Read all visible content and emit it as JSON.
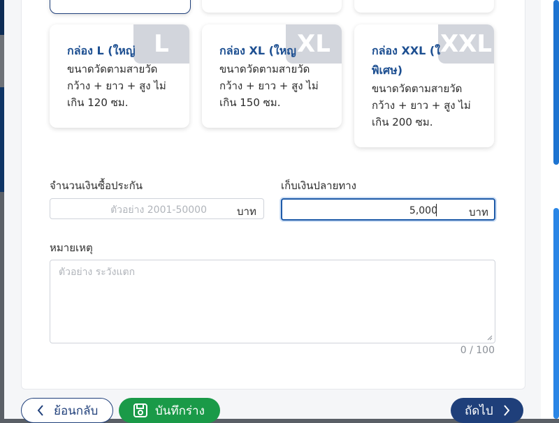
{
  "box_options": [
    {
      "title": "กล่อง L (ใหญ่",
      "badge": "L",
      "description": "ขนาดวัดตามสายวัด กว้าง + ยาว + สูง ไม่เกิน 120 ซม."
    },
    {
      "title": "กล่อง XL (ใหญ",
      "badge": "XL",
      "description": "ขนาดวัดตามสายวัด กว้าง + ยาว + สูง ไม่เกิน 150 ซม."
    },
    {
      "title": "กล่อง XXL (ใ พิเศษ)",
      "badge": "XXL",
      "description": "ขนาดวัดตามสายวัด กว้าง + ยาว + สูง ไม่เกิน 200 ซม."
    }
  ],
  "insurance": {
    "label": "จำนวนเงินซื้อประกัน",
    "placeholder": "ตัวอย่าง 2001-50000",
    "value": "",
    "unit": "บาท"
  },
  "cod": {
    "label": "เก็บเงินปลายทาง",
    "value": "5,000",
    "unit": "บาท"
  },
  "note": {
    "label": "หมายเหตุ",
    "placeholder": "ตัวอย่าง ระวังแตก",
    "counter": "0 / 100"
  },
  "buttons": {
    "back": "ย้อนกลับ",
    "save_draft": "บันทึกร่าง",
    "next": "ถัดไป"
  },
  "colors": {
    "primary": "#1f3f7a",
    "title_blue": "#1d4f91",
    "success": "#1a9a48",
    "badge_gray": "#d2d5dc"
  },
  "icons": {
    "back": "chevron-left-icon",
    "save": "save-icon",
    "next": "chevron-right-icon"
  }
}
